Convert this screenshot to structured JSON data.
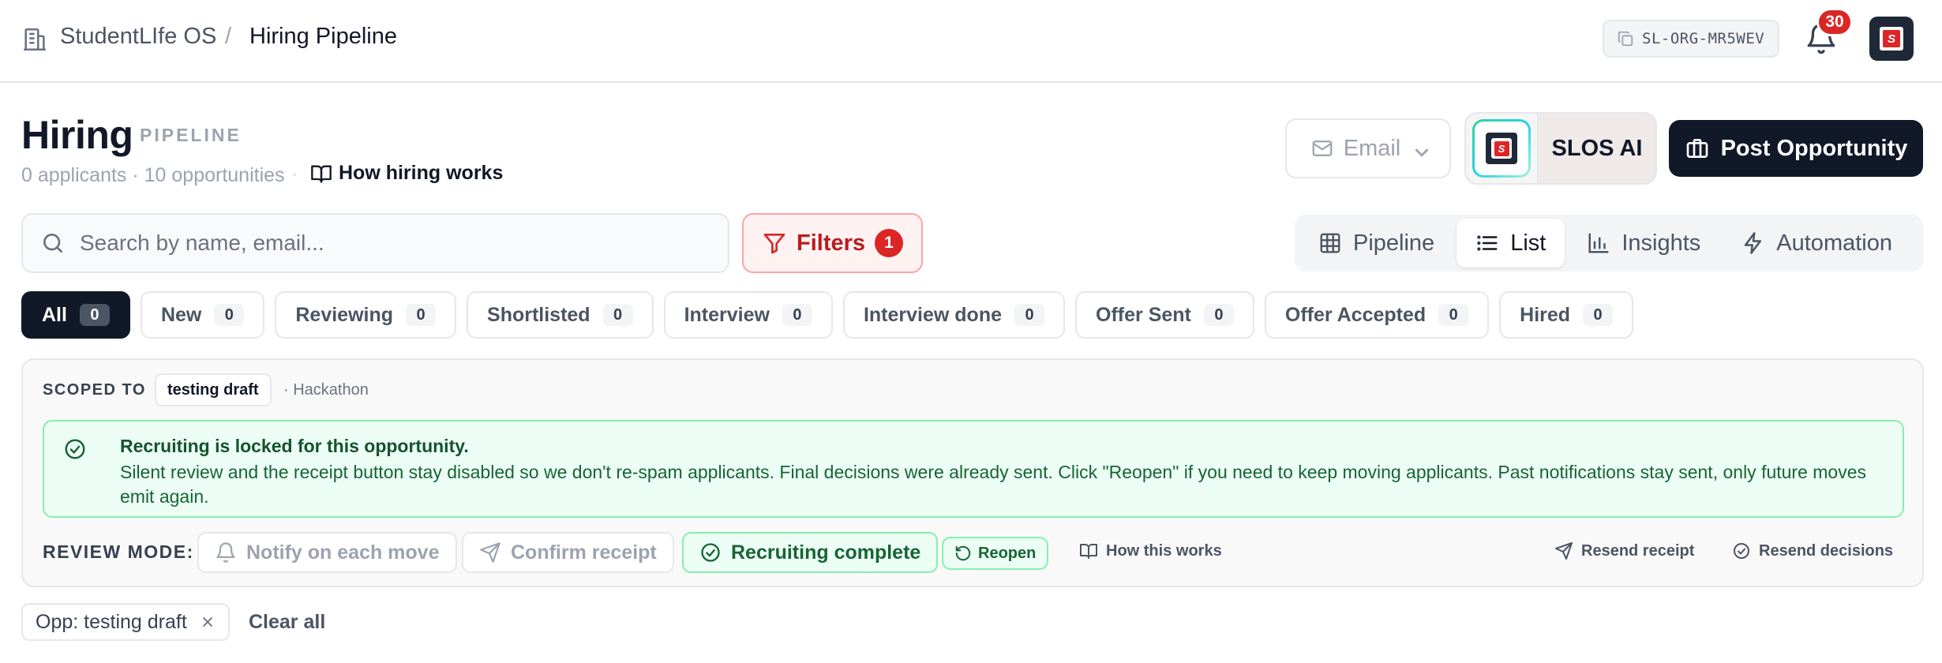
{
  "topbar": {
    "app_name": "StudentLIfe OS",
    "separator": "/",
    "page_name": "Hiring Pipeline",
    "org_id": "SL-ORG-MR5WEV",
    "notification_count": "30",
    "avatar_letter": "S"
  },
  "header": {
    "title": "Hiring",
    "subtitle": "PIPELINE",
    "meta": "0 applicants · 10 opportunities",
    "meta_sep": "·",
    "how_link": "How hiring works",
    "email_label": "Email",
    "ai_label": "SLOS AI",
    "post_label": "Post Opportunity"
  },
  "search": {
    "placeholder": "Search by name, email..."
  },
  "filters": {
    "label": "Filters",
    "count": "1"
  },
  "views": [
    {
      "label": "Pipeline",
      "icon": "grid-icon"
    },
    {
      "label": "List",
      "icon": "list-icon",
      "active": true
    },
    {
      "label": "Insights",
      "icon": "bar-chart-icon"
    },
    {
      "label": "Automation",
      "icon": "bolt-icon"
    }
  ],
  "tabs": [
    {
      "label": "All",
      "count": "0",
      "active": true
    },
    {
      "label": "New",
      "count": "0"
    },
    {
      "label": "Reviewing",
      "count": "0"
    },
    {
      "label": "Shortlisted",
      "count": "0"
    },
    {
      "label": "Interview",
      "count": "0"
    },
    {
      "label": "Interview done",
      "count": "0"
    },
    {
      "label": "Offer Sent",
      "count": "0"
    },
    {
      "label": "Offer Accepted",
      "count": "0"
    },
    {
      "label": "Hired",
      "count": "0"
    }
  ],
  "scope": {
    "label": "SCOPED TO",
    "opportunity": "testing draft",
    "type": "· Hackathon",
    "locked_title": "Recruiting is locked for this opportunity.",
    "locked_desc": "Silent review and the receipt button stay disabled so we don't re-spam applicants. Final decisions were already sent. Click \"Reopen\" if you need to keep moving applicants. Past notifications stay sent, only future moves emit again.",
    "review_label": "REVIEW MODE:",
    "notify_label": "Notify on each move",
    "confirm_label": "Confirm receipt",
    "complete_label": "Recruiting complete",
    "reopen_label": "Reopen",
    "how_label": "How this works",
    "resend_receipt": "Resend receipt",
    "resend_decisions": "Resend decisions"
  },
  "active_filters": {
    "chip": "Opp: testing draft",
    "clear_all": "Clear all"
  },
  "colors": {
    "primary_dark": "#111827",
    "danger": "#dc2626",
    "success": "#166534",
    "success_bg": "#ecfdf5"
  }
}
